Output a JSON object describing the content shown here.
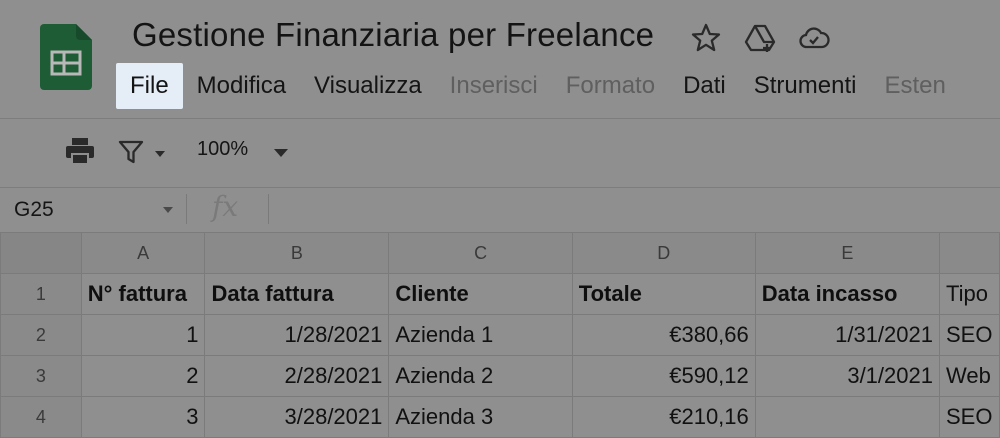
{
  "document": {
    "title": "Gestione Finanziaria per Freelance"
  },
  "header_icons": [
    "star-icon",
    "move-to-drive-icon",
    "cloud-saved-icon"
  ],
  "menu": {
    "items": [
      {
        "label": "File",
        "state": "active"
      },
      {
        "label": "Modifica",
        "state": "normal"
      },
      {
        "label": "Visualizza",
        "state": "normal"
      },
      {
        "label": "Inserisci",
        "state": "disabled"
      },
      {
        "label": "Formato",
        "state": "disabled"
      },
      {
        "label": "Dati",
        "state": "normal"
      },
      {
        "label": "Strumenti",
        "state": "normal"
      },
      {
        "label": "Esten",
        "state": "disabled"
      }
    ]
  },
  "toolbar": {
    "zoom": "100%"
  },
  "formula_bar": {
    "cell_ref": "G25",
    "fx_label": "fx"
  },
  "sheet": {
    "columns": [
      "A",
      "B",
      "C",
      "D",
      "E",
      ""
    ],
    "rows": [
      {
        "num": "1",
        "cells": [
          "N° fattura",
          "Data fattura",
          "Cliente",
          "Totale",
          "Data incasso",
          "Tipo"
        ]
      },
      {
        "num": "2",
        "cells": [
          "1",
          "1/28/2021",
          "Azienda 1",
          "€380,66",
          "1/31/2021",
          "SEO"
        ]
      },
      {
        "num": "3",
        "cells": [
          "2",
          "2/28/2021",
          "Azienda 2",
          "€590,12",
          "3/1/2021",
          "Web"
        ]
      },
      {
        "num": "4",
        "cells": [
          "3",
          "3/28/2021",
          "Azienda 3",
          "€210,16",
          "",
          "SEO"
        ]
      }
    ]
  },
  "colors": {
    "accent_green": "#1e8e3e",
    "menu_highlight": "#e5edf7",
    "overlay_gray": "#8f8f8f"
  }
}
